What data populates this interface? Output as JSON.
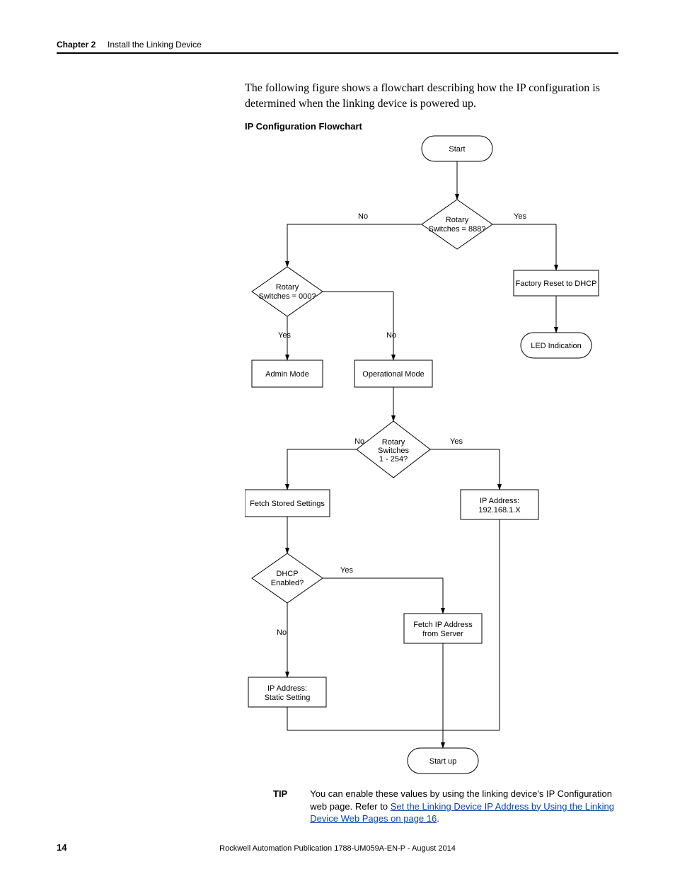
{
  "header": {
    "chapter": "Chapter 2",
    "title": "Install the Linking Device"
  },
  "intro": "The following figure shows a flowchart describing how the IP configuration is determined when the linking device is powered up.",
  "flow_title": "IP Configuration Flowchart",
  "nodes": {
    "start": "Start",
    "rotary888": "Rotary Switches = 888?",
    "factory_reset": "Factory Reset to DHCP",
    "led": "LED Indication",
    "rotary000": "Rotary Switches = 000?",
    "admin": "Admin Mode",
    "operational": "Operational Mode",
    "rotary1_254": "Rotary Switches 1 - 254?",
    "ip_192": "IP Address: 192.168.1.X",
    "fetch_stored": "Fetch Stored Settings",
    "dhcp_enabled": "DHCP Enabled?",
    "fetch_server": "Fetch IP Address from Server",
    "ip_static": "IP Address: Static Setting",
    "startup": "Start up"
  },
  "edges": {
    "yes": "Yes",
    "no": "No"
  },
  "tip": {
    "label": "TIP",
    "text_before": "You can enable these values by using the linking device's IP Configuration web page. Refer to ",
    "link": "Set the Linking Device IP Address by Using the Linking Device Web Pages on page 16",
    "text_after": "."
  },
  "footer": {
    "page": "14",
    "pub": "Rockwell Automation Publication 1788-UM059A-EN-P - August 2014"
  }
}
